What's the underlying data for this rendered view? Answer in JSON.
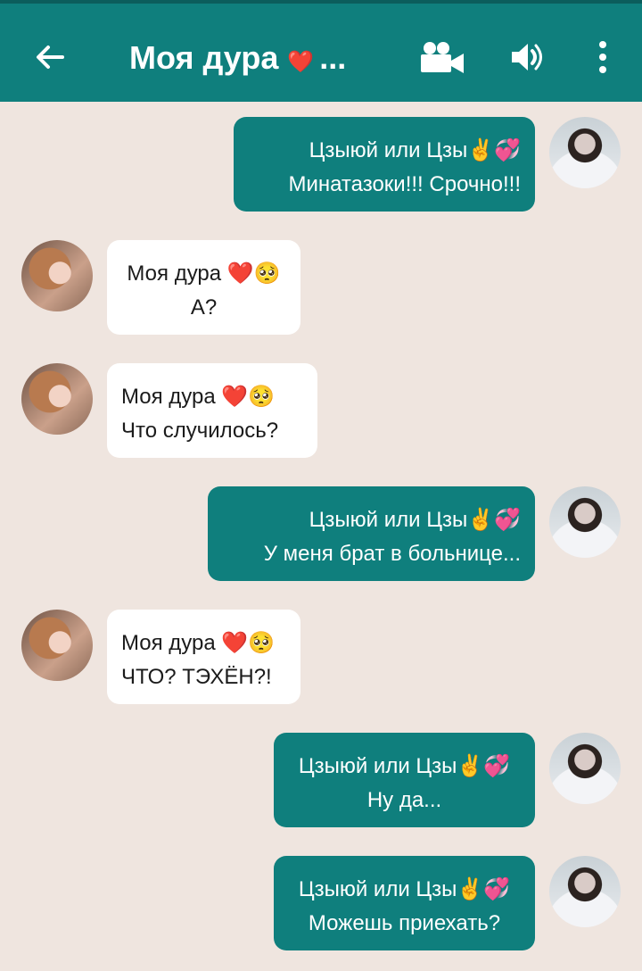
{
  "header": {
    "title": "Моя дура",
    "title_emoji": "❤️",
    "title_suffix": "..."
  },
  "colors": {
    "accent": "#0f7f7d",
    "background": "#efe5df",
    "incoming_bubble": "#ffffff"
  },
  "icons": {
    "back": "arrow-left-icon",
    "video": "video-camera-icon",
    "sound": "speaker-icon",
    "more": "more-vertical-icon"
  },
  "messages": [
    {
      "direction": "outgoing",
      "sender": "Цзыюй или Цзы",
      "emoji": "✌️💞",
      "text": "Минатазоки!!! Срочно!!!"
    },
    {
      "direction": "incoming",
      "sender": "Моя дура",
      "emoji": "❤️🥺",
      "text": "А?"
    },
    {
      "direction": "incoming",
      "sender": "Моя дура",
      "emoji": "❤️🥺",
      "text": "Что случилось?"
    },
    {
      "direction": "outgoing",
      "sender": "Цзыюй или Цзы",
      "emoji": "✌️💞",
      "text": "У меня брат в больнице..."
    },
    {
      "direction": "incoming",
      "sender": "Моя дура",
      "emoji": "❤️🥺",
      "text": "ЧТО? ТЭХЁН?!"
    },
    {
      "direction": "outgoing",
      "sender": "Цзыюй или Цзы",
      "emoji": "✌️💞",
      "text": "Ну да..."
    },
    {
      "direction": "outgoing",
      "sender": "Цзыюй или Цзы",
      "emoji": "✌️💞",
      "text": "Можешь приехать?"
    }
  ]
}
